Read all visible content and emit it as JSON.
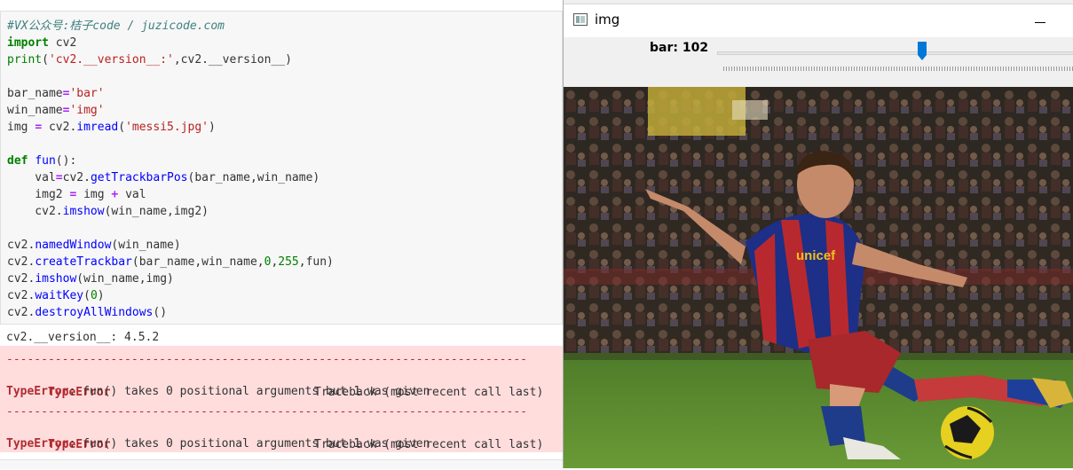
{
  "notebook": {
    "code_lines": [
      [
        {
          "c": "cmt",
          "t": "#VX公众号:桔子code / juzicode.com"
        }
      ],
      [
        {
          "c": "kw",
          "t": "import"
        },
        {
          "c": "pl",
          "t": " cv2"
        }
      ],
      [
        {
          "c": "bi",
          "t": "print"
        },
        {
          "c": "pl",
          "t": "("
        },
        {
          "c": "str",
          "t": "'cv2.__version__:'"
        },
        {
          "c": "pl",
          "t": ",cv2.__version__)"
        }
      ],
      [
        {
          "c": "pl",
          "t": ""
        }
      ],
      [
        {
          "c": "pl",
          "t": "bar_name"
        },
        {
          "c": "op",
          "t": "="
        },
        {
          "c": "str",
          "t": "'bar'"
        }
      ],
      [
        {
          "c": "pl",
          "t": "win_name"
        },
        {
          "c": "op",
          "t": "="
        },
        {
          "c": "str",
          "t": "'img'"
        }
      ],
      [
        {
          "c": "pl",
          "t": "img "
        },
        {
          "c": "op",
          "t": "="
        },
        {
          "c": "pl",
          "t": " cv2."
        },
        {
          "c": "fn",
          "t": "imread"
        },
        {
          "c": "pl",
          "t": "("
        },
        {
          "c": "str",
          "t": "'messi5.jpg'"
        },
        {
          "c": "pl",
          "t": ")"
        }
      ],
      [
        {
          "c": "pl",
          "t": ""
        }
      ],
      [
        {
          "c": "kw",
          "t": "def"
        },
        {
          "c": "pl",
          "t": " "
        },
        {
          "c": "fn",
          "t": "fun"
        },
        {
          "c": "pl",
          "t": "():"
        }
      ],
      [
        {
          "c": "pl",
          "t": "    val"
        },
        {
          "c": "op",
          "t": "="
        },
        {
          "c": "pl",
          "t": "cv2."
        },
        {
          "c": "fn",
          "t": "getTrackbarPos"
        },
        {
          "c": "pl",
          "t": "(bar_name,win_name)"
        }
      ],
      [
        {
          "c": "pl",
          "t": "    img2 "
        },
        {
          "c": "op",
          "t": "="
        },
        {
          "c": "pl",
          "t": " img "
        },
        {
          "c": "op",
          "t": "+"
        },
        {
          "c": "pl",
          "t": " val"
        }
      ],
      [
        {
          "c": "pl",
          "t": "    cv2."
        },
        {
          "c": "fn",
          "t": "imshow"
        },
        {
          "c": "pl",
          "t": "(win_name,img2)"
        }
      ],
      [
        {
          "c": "pl",
          "t": ""
        }
      ],
      [
        {
          "c": "pl",
          "t": "cv2."
        },
        {
          "c": "fn",
          "t": "namedWindow"
        },
        {
          "c": "pl",
          "t": "(win_name)"
        }
      ],
      [
        {
          "c": "pl",
          "t": "cv2."
        },
        {
          "c": "fn",
          "t": "createTrackbar"
        },
        {
          "c": "pl",
          "t": "(bar_name,win_name,"
        },
        {
          "c": "num",
          "t": "0"
        },
        {
          "c": "pl",
          "t": ","
        },
        {
          "c": "num",
          "t": "255"
        },
        {
          "c": "pl",
          "t": ",fun)"
        }
      ],
      [
        {
          "c": "pl",
          "t": "cv2."
        },
        {
          "c": "fn",
          "t": "imshow"
        },
        {
          "c": "pl",
          "t": "(win_name,img)"
        }
      ],
      [
        {
          "c": "pl",
          "t": "cv2."
        },
        {
          "c": "fn",
          "t": "waitKey"
        },
        {
          "c": "pl",
          "t": "("
        },
        {
          "c": "num",
          "t": "0"
        },
        {
          "c": "pl",
          "t": ")"
        }
      ],
      [
        {
          "c": "pl",
          "t": "cv2."
        },
        {
          "c": "fn",
          "t": "destroyAllWindows"
        },
        {
          "c": "pl",
          "t": "()"
        }
      ]
    ],
    "stdout": "cv2.__version__: 4.5.2",
    "errors": [
      {
        "dashes": "---------------------------------------------------------------------------",
        "name": "TypeError",
        "traceback": "Traceback (most recent call last)",
        "message": ": fun() takes 0 positional arguments but 1 was given"
      },
      {
        "dashes": "---------------------------------------------------------------------------",
        "name": "TypeError",
        "traceback": "Traceback (most recent call last)",
        "message": ": fun() takes 0 positional arguments but 1 was given"
      }
    ]
  },
  "window": {
    "title": "img",
    "trackbar": {
      "label": "bar: 102",
      "value": 102,
      "min": 0,
      "max": 255
    },
    "image_alt": "soccer player kicking ball",
    "jersey_text": "unicef"
  },
  "colors": {
    "error_bg": "#ffdddd",
    "error_red": "#b22b31",
    "thumb_blue": "#0078d7"
  }
}
